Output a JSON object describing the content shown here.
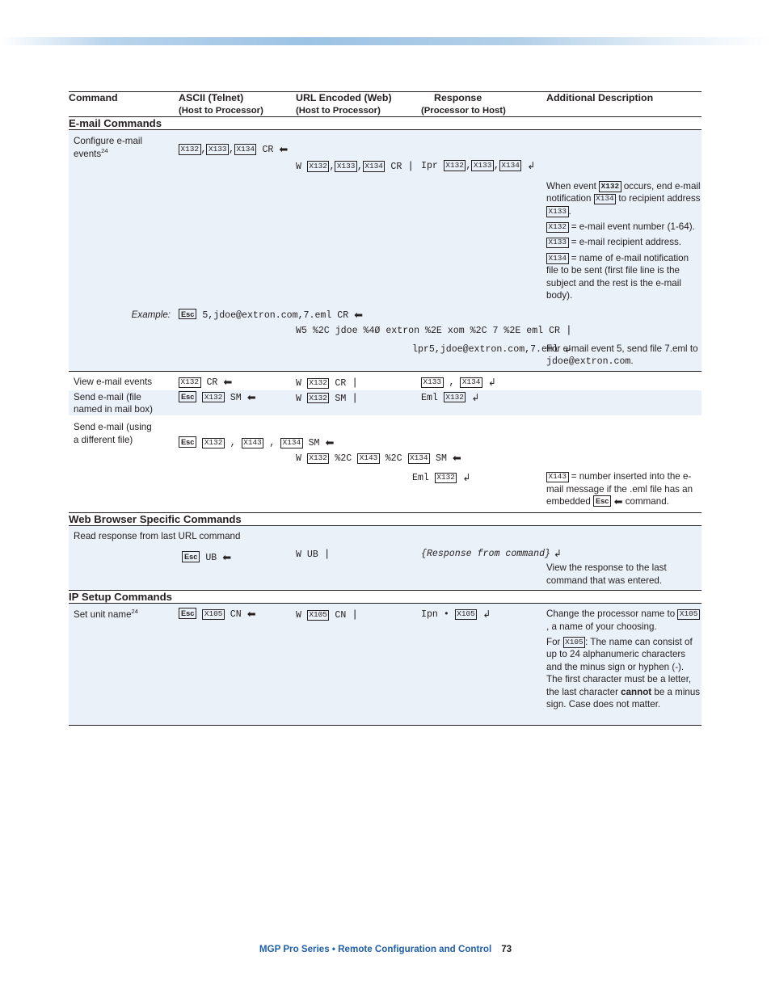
{
  "document": {
    "footer_title": "MGP Pro Series • Remote Configuration and Control",
    "page_number": "73"
  },
  "table": {
    "headers": [
      {
        "title": "Command",
        "sub": ""
      },
      {
        "title": "ASCII (Telnet)",
        "sub": "(Host to Processor)"
      },
      {
        "title": "URL Encoded (Web)",
        "sub": "(Host to Processor)"
      },
      {
        "title": "Response",
        "sub": "(Processor to Host)"
      },
      {
        "title": "Additional Description",
        "sub": ""
      }
    ],
    "sections": [
      {
        "id": "email",
        "label": "E-mail Commands"
      },
      {
        "id": "web",
        "label": "Web Browser Specific Commands"
      },
      {
        "id": "ip",
        "label": "IP Setup Commands"
      }
    ],
    "rows": {
      "configure_email": {
        "command": "Configure e-mail events",
        "command_sup": "24",
        "ascii": "X132 , X133 , X134  CR ←",
        "url": "W X132 , X133 , X134  CR |",
        "response": "Ipr X132 , X133 , X134 ↵",
        "desc_1": "When event X132 occurs, end e-mail notification X134 to recipient address X133 .",
        "desc_2": "X132 = e-mail event number (1-64).",
        "desc_3": "X133 = e-mail recipient address.",
        "desc_4": "X134 = name of e-mail notification file to be sent (first file line is the subject and the rest is the e-mail body)."
      },
      "configure_email_example": {
        "label": "Example:",
        "ascii": "Esc 5,jdoe@extron.com,7.eml CR ←",
        "url": "W5 %2C jdoe %4Ø extron %2E xom %2C 7 %2E eml CR |",
        "response": "Ipr5,jdoe@extron.com,7.eml ↵",
        "desc": "For e-mail event 5, send file 7.eml to jdoe@extron.com."
      },
      "view_email_events": {
        "command": "View e-mail events",
        "ascii": "X132 CR ←",
        "url": "W X132 CR |",
        "response": "X133 , X134 ↵"
      },
      "send_email_mailbox": {
        "command": "Send e-mail (file named in mail box)",
        "ascii": "Esc X132 SM ←",
        "url": "W X132 SM |",
        "response": "Eml X132 ↵"
      },
      "send_email_different": {
        "command": "Send e-mail (using a different file)",
        "ascii": "Esc X132 , X143 , X134 SM ←",
        "url": "W X132 %2C X143 %2C X134 SM ←",
        "response": "Eml X132 ↵",
        "desc": "X143 = number inserted into the e-mail message if the .eml file has an embedded Esc ← command."
      },
      "read_response": {
        "command": "Read response from last URL command",
        "ascii": "Esc UB ←",
        "url": "W UB |",
        "response": "{Response from command} ↵",
        "desc": "View the response to the last command that was entered."
      },
      "set_unit_name": {
        "command": "Set unit name",
        "command_sup": "24",
        "ascii": "Esc X105 CN ←",
        "url": "W X105 CN |",
        "response": "Ipn • X105 ↵",
        "desc_1": "Change the processor name to X105 , a name of your choosing.",
        "desc_2": "For X105 : The name can consist of up to 24 alphanumeric characters and the minus sign or hyphen (-). The first character must be a letter, the last character cannot be a minus sign. Case does not matter."
      }
    }
  }
}
